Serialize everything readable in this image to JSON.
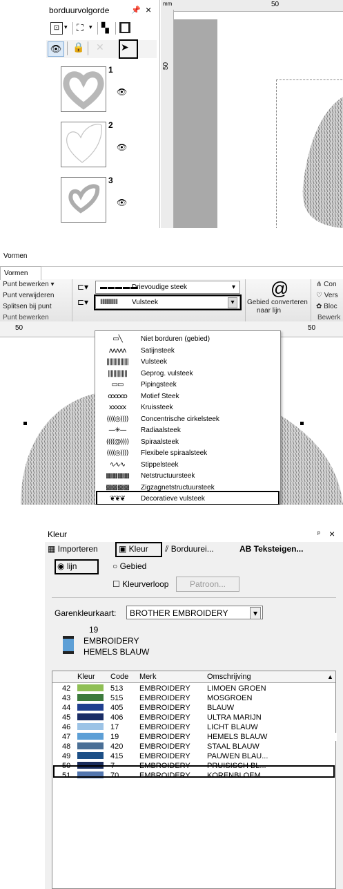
{
  "panel1": {
    "title": "borduurvolgorde",
    "pin": "ᵖ",
    "close": "×",
    "ruler_unit": "mm",
    "ruler_top_value": "50",
    "ruler_left_value": "50",
    "layers": [
      {
        "number": "1"
      },
      {
        "number": "2"
      },
      {
        "number": "3"
      }
    ]
  },
  "panel2": {
    "tab_top": "Vormen",
    "tab_active": "Vormen",
    "left_group": [
      "Punt bewerken",
      "Punt verwijderen",
      "Splitsen bij punt"
    ],
    "left_group_footer": "Punt bewerken",
    "combo_top": "Drievoudige steek",
    "combo_bottom": "Vulsteek",
    "convert_label_1": "Gebied converteren",
    "convert_label_2": "naar lijn",
    "right_items": [
      "Con",
      "Vers",
      "Bloc"
    ],
    "right_footer": "Bewerk",
    "ruler_left": "50",
    "ruler_right": "50",
    "menu_items": [
      {
        "icon": "line-none",
        "label": "Niet borduren (gebied)"
      },
      {
        "icon": "satin",
        "label": "Satijnsteek"
      },
      {
        "icon": "fill",
        "label": "Vulsteek"
      },
      {
        "icon": "prog-fill",
        "label": "Geprog. vulsteek"
      },
      {
        "icon": "piping",
        "label": "Pipingsteek"
      },
      {
        "icon": "motif",
        "label": "Motief Steek"
      },
      {
        "icon": "cross",
        "label": "Kruissteek"
      },
      {
        "icon": "concentric",
        "label": "Concentrische cirkelsteek"
      },
      {
        "icon": "radial",
        "label": "Radiaalsteek"
      },
      {
        "icon": "spiral",
        "label": "Spiraalsteek"
      },
      {
        "icon": "flex-spiral",
        "label": "Flexibele spiraalsteek"
      },
      {
        "icon": "stipple",
        "label": "Stippelsteek"
      },
      {
        "icon": "net",
        "label": "Netstructuursteek"
      },
      {
        "icon": "zigzag-net",
        "label": "Zigzagnetstructuursteek"
      },
      {
        "icon": "decorative",
        "label": "Decoratieve vulsteek"
      }
    ]
  },
  "panel3": {
    "title": "Kleur",
    "pin": "ᵖ",
    "close": "×",
    "tabs": [
      {
        "icon": "import-icon",
        "label": "Importeren"
      },
      {
        "icon": "spool-icon",
        "label": "Kleur"
      },
      {
        "icon": "stitch-icon",
        "label": "Borduurei..."
      },
      {
        "icon": "text-icon",
        "label": "AB Teksteigen..."
      }
    ],
    "radio_line": "lijn",
    "radio_area": "Gebied",
    "checkbox_gradient": "Kleurverloop",
    "pattern_button": "Patroon...",
    "chart_label": "Garenkleurkaart:",
    "chart_value": "BROTHER EMBROIDERY",
    "current_code": "19",
    "current_brand": "EMBROIDERY",
    "current_name": "HEMELS BLAUW",
    "headers": [
      "Kleur",
      "Code",
      "Merk",
      "Omschrijving"
    ],
    "rows": [
      {
        "idx": "42",
        "color": "#8fbf55",
        "code": "513",
        "brand": "EMBROIDERY",
        "desc": "LIMOEN GROEN"
      },
      {
        "idx": "43",
        "color": "#3c7a3c",
        "code": "515",
        "brand": "EMBROIDERY",
        "desc": "MOSGROEN"
      },
      {
        "idx": "44",
        "color": "#1f3f8f",
        "code": "405",
        "brand": "EMBROIDERY",
        "desc": "BLAUW"
      },
      {
        "idx": "45",
        "color": "#1a2d66",
        "code": "406",
        "brand": "EMBROIDERY",
        "desc": "ULTRA MARIJN"
      },
      {
        "idx": "46",
        "color": "#9cc3e6",
        "code": "17",
        "brand": "EMBROIDERY",
        "desc": "LICHT BLAUW"
      },
      {
        "idx": "47",
        "color": "#5d9fd6",
        "code": "19",
        "brand": "EMBROIDERY",
        "desc": "HEMELS BLAUW"
      },
      {
        "idx": "48",
        "color": "#4a6f96",
        "code": "420",
        "brand": "EMBROIDERY",
        "desc": "STAAL BLAUW"
      },
      {
        "idx": "49",
        "color": "#1c4f86",
        "code": "415",
        "brand": "EMBROIDERY",
        "desc": "PAUWEN BLAU..."
      },
      {
        "idx": "50",
        "color": "#1b2d5c",
        "code": "7",
        "brand": "EMBROIDERY",
        "desc": "PRUISISCH BL..."
      },
      {
        "idx": "51",
        "color": "#5377b0",
        "code": "70",
        "brand": "EMBROIDERY",
        "desc": "KORENBLOEM..."
      }
    ]
  }
}
